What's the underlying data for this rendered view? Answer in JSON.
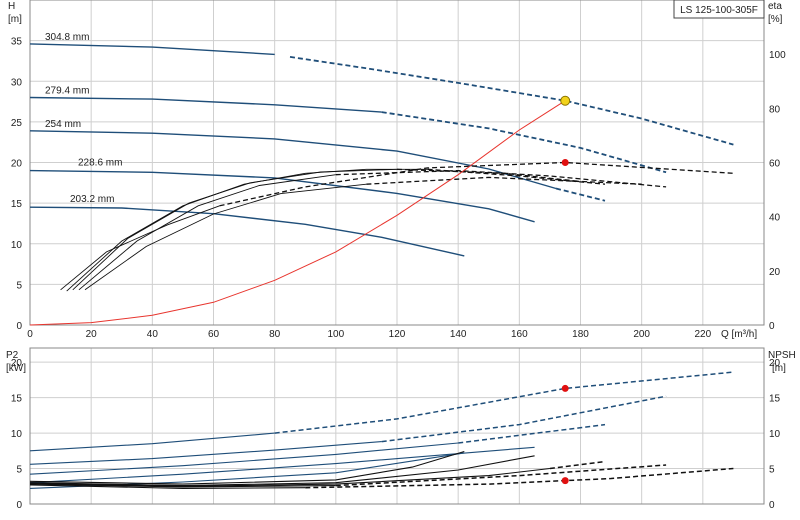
{
  "model_label": "LS 125-100-305F",
  "colors": {
    "blue": "#1f4e79",
    "black": "#111111",
    "red": "#e8352e",
    "grid": "#cfcfcf",
    "marker_yellow": "#f2d21b",
    "marker_red": "#e01010"
  },
  "chart_data": [
    {
      "type": "line",
      "title": "",
      "xlabel": "Q [m³/h]",
      "ylabel_left": "H\n[m]",
      "ylabel_right": "eta\n[%]",
      "xlim": [
        0,
        240
      ],
      "ylim_left": [
        0,
        40
      ],
      "ylim_right": [
        0,
        120
      ],
      "grid": true,
      "x_ticks": [
        0,
        20,
        40,
        60,
        80,
        100,
        120,
        140,
        160,
        180,
        200,
        220
      ],
      "y_ticks_left": [
        0,
        5,
        10,
        15,
        20,
        25,
        30,
        35
      ],
      "y_ticks_right": [
        0,
        20,
        40,
        60,
        80,
        100
      ],
      "head_curves": [
        {
          "name": "304.8 mm",
          "solid": [
            [
              0,
              34.6
            ],
            [
              40,
              34.2
            ],
            [
              80,
              33.3
            ]
          ],
          "dashed": [
            [
              85,
              33.0
            ],
            [
              110,
              31.6
            ],
            [
              140,
              29.8
            ],
            [
              175,
              27.6
            ],
            [
              200,
              25.4
            ],
            [
              230,
              22.2
            ]
          ]
        },
        {
          "name": "279.4 mm",
          "solid": [
            [
              0,
              28.0
            ],
            [
              40,
              27.8
            ],
            [
              80,
              27.1
            ],
            [
              115,
              26.2
            ]
          ],
          "dashed": [
            [
              115,
              26.2
            ],
            [
              150,
              24.2
            ],
            [
              180,
              21.8
            ],
            [
              208,
              18.8
            ]
          ]
        },
        {
          "name": "254 mm",
          "solid": [
            [
              0,
              23.9
            ],
            [
              40,
              23.6
            ],
            [
              80,
              22.9
            ],
            [
              120,
              21.4
            ],
            [
              150,
              19.2
            ],
            [
              172,
              16.8
            ]
          ],
          "dashed": [
            [
              172,
              16.8
            ],
            [
              188,
              15.3
            ]
          ]
        },
        {
          "name": "228.6 mm",
          "solid": [
            [
              0,
              19.0
            ],
            [
              40,
              18.8
            ],
            [
              80,
              18.1
            ],
            [
              120,
              16.2
            ],
            [
              150,
              14.3
            ],
            [
              165,
              12.7
            ]
          ],
          "dashed": []
        },
        {
          "name": "203.2 mm",
          "solid": [
            [
              0,
              14.5
            ],
            [
              30,
              14.4
            ],
            [
              60,
              13.7
            ],
            [
              90,
              12.4
            ],
            [
              115,
              10.8
            ],
            [
              142,
              8.5
            ]
          ],
          "dashed": []
        }
      ],
      "efficiency_curves": [
        {
          "solid": [
            [
              12,
              12.5
            ],
            [
              30,
              31
            ],
            [
              50,
              44
            ],
            [
              70,
              52
            ],
            [
              90,
              56
            ],
            [
              110,
              57.5
            ],
            [
              130,
              57.5
            ]
          ],
          "dashed": [
            [
              130,
              57.5
            ],
            [
              160,
              55
            ],
            [
              188,
              52
            ]
          ]
        },
        {
          "solid": [
            [
              14,
              13
            ],
            [
              32,
              32
            ],
            [
              52,
              45
            ],
            [
              72,
              52.5
            ],
            [
              95,
              56.5
            ],
            [
              120,
              57.5
            ]
          ],
          "dashed": [
            [
              120,
              57.5
            ],
            [
              155,
              56
            ],
            [
              180,
              53
            ]
          ]
        },
        {
          "solid": [
            [
              16,
              13
            ],
            [
              35,
              31
            ],
            [
              55,
              44
            ],
            [
              75,
              51.5
            ],
            [
              100,
              55.5
            ]
          ],
          "dashed": [
            [
              100,
              55.5
            ],
            [
              140,
              57
            ],
            [
              170,
              55
            ],
            [
              208,
              51
            ]
          ]
        },
        {
          "solid": [
            [
              18,
              13
            ],
            [
              38,
              29
            ],
            [
              60,
              41
            ],
            [
              82,
              48.5
            ],
            [
              110,
              52
            ]
          ],
          "dashed": [
            [
              110,
              52
            ],
            [
              150,
              54.5
            ],
            [
              200,
              52
            ]
          ]
        },
        {
          "solid": [
            [
              10,
              13
            ],
            [
              25,
              27
            ],
            [
              45,
              37
            ],
            [
              62,
              44
            ]
          ],
          "dashed": [
            [
              62,
              44
            ],
            [
              90,
              51
            ],
            [
              130,
              58
            ],
            [
              175,
              60
            ],
            [
              230,
              56
            ]
          ]
        }
      ],
      "system_curve": [
        [
          0,
          0
        ],
        [
          20,
          0.3
        ],
        [
          40,
          1.2
        ],
        [
          60,
          2.8
        ],
        [
          80,
          5.5
        ],
        [
          100,
          9.0
        ],
        [
          120,
          13.5
        ],
        [
          140,
          18.5
        ],
        [
          160,
          24.0
        ],
        [
          175,
          27.6
        ]
      ],
      "duty_points": [
        {
          "x": 175,
          "y_left": 27.6,
          "color": "marker_yellow"
        },
        {
          "x": 175,
          "y_right": 60,
          "color": "marker_red"
        }
      ]
    },
    {
      "type": "line",
      "title": "",
      "xlabel": "",
      "ylabel_left": "P2\n[kW]",
      "ylabel_right": "NPSH\n[m]",
      "xlim": [
        0,
        240
      ],
      "ylim_left": [
        0,
        22
      ],
      "ylim_right": [
        0,
        22
      ],
      "grid": true,
      "y_ticks_left": [
        0,
        5,
        10,
        15,
        20
      ],
      "y_ticks_right": [
        0,
        5,
        10,
        15,
        20
      ],
      "power_curves": [
        {
          "solid": [
            [
              0,
              7.5
            ],
            [
              40,
              8.5
            ],
            [
              80,
              10.0
            ]
          ],
          "dashed": [
            [
              80,
              10.0
            ],
            [
              120,
              12.0
            ],
            [
              175,
              16.3
            ],
            [
              230,
              18.6
            ]
          ]
        },
        {
          "solid": [
            [
              0,
              5.6
            ],
            [
              40,
              6.4
            ],
            [
              80,
              7.6
            ],
            [
              115,
              8.8
            ]
          ],
          "dashed": [
            [
              115,
              8.8
            ],
            [
              160,
              11.2
            ],
            [
              208,
              15.2
            ]
          ]
        },
        {
          "solid": [
            [
              0,
              4.2
            ],
            [
              50,
              5.4
            ],
            [
              100,
              7.0
            ],
            [
              140,
              8.6
            ]
          ],
          "dashed": [
            [
              140,
              8.6
            ],
            [
              188,
              11.2
            ]
          ]
        },
        {
          "solid": [
            [
              0,
              3.0
            ],
            [
              50,
              4.2
            ],
            [
              100,
              5.7
            ],
            [
              165,
              8.0
            ]
          ],
          "dashed": []
        },
        {
          "solid": [
            [
              0,
              2.2
            ],
            [
              50,
              3.1
            ],
            [
              100,
              4.4
            ],
            [
              142,
              7.2
            ]
          ],
          "dashed": []
        }
      ],
      "npsh_curves": [
        {
          "solid": [
            [
              0,
              3.2
            ],
            [
              50,
              2.8
            ],
            [
              100,
              3.4
            ],
            [
              125,
              5.2
            ],
            [
              142,
              7.4
            ]
          ],
          "dashed": []
        },
        {
          "solid": [
            [
              0,
              3.0
            ],
            [
              50,
              2.6
            ],
            [
              100,
              3.0
            ],
            [
              140,
              4.8
            ],
            [
              165,
              6.8
            ]
          ],
          "dashed": []
        },
        {
          "solid": [
            [
              0,
              2.9
            ],
            [
              50,
              2.5
            ],
            [
              100,
              2.8
            ],
            [
              150,
              4.0
            ],
            [
              170,
              5.0
            ]
          ],
          "dashed": [
            [
              170,
              5.0
            ],
            [
              188,
              6.0
            ]
          ]
        },
        {
          "solid": [
            [
              0,
              2.8
            ],
            [
              50,
              2.4
            ],
            [
              100,
              2.6
            ]
          ],
          "dashed": [
            [
              100,
              2.6
            ],
            [
              160,
              4.0
            ],
            [
              208,
              5.5
            ]
          ]
        },
        {
          "solid": [
            [
              0,
              2.7
            ],
            [
              50,
              2.2
            ],
            [
              90,
              2.3
            ]
          ],
          "dashed": [
            [
              90,
              2.3
            ],
            [
              150,
              2.8
            ],
            [
              190,
              3.6
            ],
            [
              230,
              5.0
            ]
          ]
        }
      ],
      "duty_points": [
        {
          "x": 175,
          "y": 16.3,
          "color": "marker_red"
        },
        {
          "x": 175,
          "y": 3.3,
          "color": "marker_red"
        }
      ]
    }
  ]
}
